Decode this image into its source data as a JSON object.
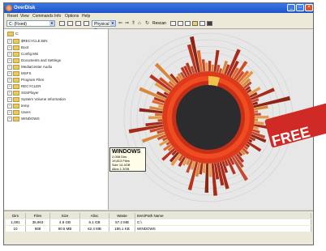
{
  "window": {
    "title": "OverDisk"
  },
  "menu": {
    "items": [
      "Reset",
      "View",
      "Commands",
      "Info",
      "Options",
      "Help"
    ]
  },
  "toolbar": {
    "drive": "C: (Fixed)",
    "mode": "Physical Size",
    "rescan_label": "Rescan"
  },
  "tree": {
    "items": [
      {
        "label": "C:",
        "expander": ""
      },
      {
        "label": "$RECYCLE.BIN",
        "expander": "+"
      },
      {
        "label": "Boot",
        "expander": "+"
      },
      {
        "label": "Config.Msi",
        "expander": "+"
      },
      {
        "label": "Documents and Settings",
        "expander": "+"
      },
      {
        "label": "MediaCenter Audio",
        "expander": "+"
      },
      {
        "label": "MSFS",
        "expander": "+"
      },
      {
        "label": "Program Files",
        "expander": "+"
      },
      {
        "label": "RECYCLER",
        "expander": "+"
      },
      {
        "label": "SSSPlayer",
        "expander": "+"
      },
      {
        "label": "System Volume Information",
        "expander": "+"
      },
      {
        "label": "temp",
        "expander": "+"
      },
      {
        "label": "Users",
        "expander": "+"
      },
      {
        "label": "WINDOWS",
        "expander": "+"
      }
    ]
  },
  "chart_label": {
    "name": "WINDOWS",
    "lines": [
      "2,058 Dirs",
      "19,813 Files",
      "Size 14.4GB",
      "Alloc 1.3GB"
    ]
  },
  "status": {
    "headers": [
      "Dirs",
      "Files",
      "Size",
      "Alloc",
      "Waste",
      "Item/Path Name"
    ],
    "rows": [
      [
        "1,081",
        "35,963",
        "4.8 GB",
        "6.1 GB",
        "57.2 MB",
        "C:\\"
      ],
      [
        "10",
        "688",
        "90.5 MB",
        "62.4 MB",
        "186.1 KB",
        "WINDOWS"
      ]
    ]
  },
  "badge": {
    "text": "FREE"
  },
  "colors": {
    "accent": "#d02a26",
    "outer_ring": "#e8411d",
    "core": "#2c2c2e"
  }
}
